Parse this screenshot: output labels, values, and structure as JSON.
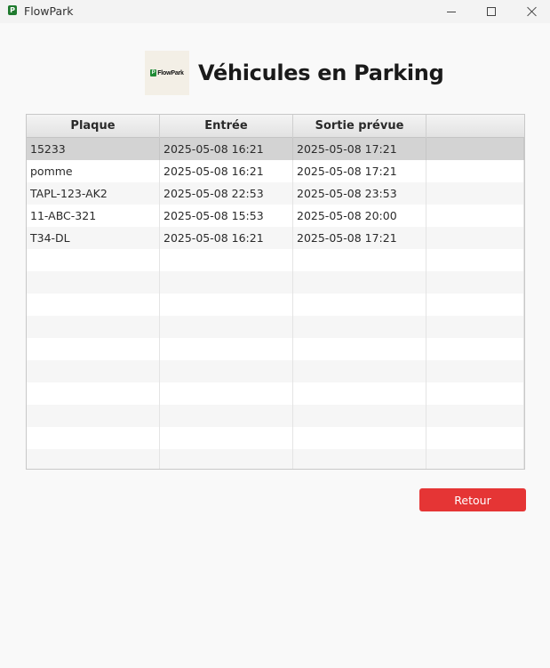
{
  "window": {
    "title": "FlowPark",
    "icon_letter": "P",
    "controls": [
      "minimize-icon",
      "maximize-icon",
      "close-icon"
    ]
  },
  "header": {
    "logo_mark": "P",
    "logo_text": "FlowPark",
    "title": "Véhicules en Parking"
  },
  "table": {
    "columns": [
      "Plaque",
      "Entrée",
      "Sortie prévue",
      ""
    ],
    "rows": [
      [
        "15233",
        "2025-05-08 16:21",
        "2025-05-08 17:21",
        ""
      ],
      [
        "pomme",
        "2025-05-08 16:21",
        "2025-05-08 17:21",
        ""
      ],
      [
        "TAPL-123-AK2",
        "2025-05-08 22:53",
        "2025-05-08 23:53",
        ""
      ],
      [
        "11-ABC-321",
        "2025-05-08 15:53",
        "2025-05-08 20:00",
        ""
      ],
      [
        "T34-DL",
        "2025-05-08 16:21",
        "2025-05-08 17:21",
        ""
      ]
    ],
    "selected_row": 0,
    "empty_rows": 10
  },
  "actions": {
    "back_label": "Retour"
  },
  "colors": {
    "accent_button": "#e53535",
    "logo_green": "#1f8a35",
    "selected_row": "#d3d3d3"
  }
}
